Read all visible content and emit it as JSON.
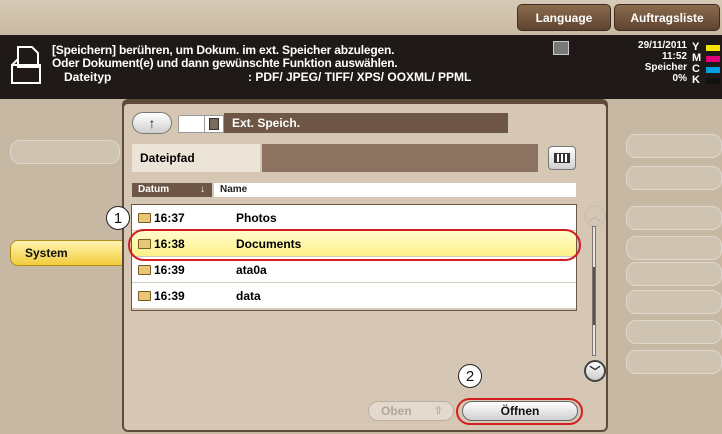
{
  "topbar": {
    "language_label": "Language",
    "jobs_label": "Auftragsliste"
  },
  "message": {
    "line1": "[Speichern] berühren, um Dokum. im ext. Speicher abzulegen.",
    "line2": "Oder Dokument(e) und dann gewünschte Funktion auswählen.",
    "filetype_label": "Dateityp",
    "filetype_value": ": PDF/ JPEG/ TIFF/ XPS/ OOXML/ PPML"
  },
  "status": {
    "date": "29/11/2011",
    "time": "11:52",
    "storage_label": "Speicher",
    "storage_value": "0%",
    "toner": [
      {
        "label": "Y",
        "color": "#f2e600"
      },
      {
        "label": "M",
        "color": "#e0007a"
      },
      {
        "label": "C",
        "color": "#00a0e0"
      },
      {
        "label": "K",
        "color": "#111111"
      }
    ]
  },
  "sidebar": {
    "system_label": "System"
  },
  "browser": {
    "up_icon": "up-arrow-icon",
    "location_label": "Ext. Speich.",
    "filepath_label": "Dateipfad",
    "filepath_value": "",
    "columns": {
      "date": "Datum",
      "sort_glyph": "↓",
      "name": "Name"
    },
    "files": [
      {
        "time": "16:37",
        "name": "Photos",
        "selected": false
      },
      {
        "time": "16:38",
        "name": "Documents",
        "selected": true
      },
      {
        "time": "16:39",
        "name": "ata0a",
        "selected": false
      },
      {
        "time": "16:39",
        "name": "data",
        "selected": false
      }
    ],
    "top_button_label": "Oben",
    "open_button_label": "Öffnen"
  },
  "callouts": {
    "step1": "1",
    "step2": "2"
  }
}
